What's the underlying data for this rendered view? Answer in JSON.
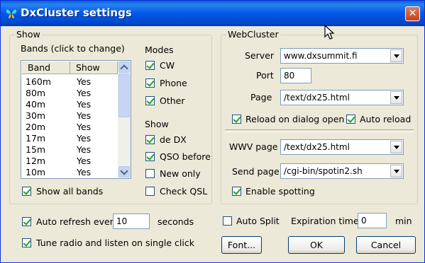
{
  "window": {
    "title": "DxCluster settings",
    "close_label": "✕"
  },
  "show_group": {
    "label": "Show",
    "bands_label": "Bands (click to change)",
    "bands_header": {
      "band": "Band",
      "show": "Show"
    },
    "bands": [
      {
        "band": "160m",
        "show": "Yes"
      },
      {
        "band": "80m",
        "show": "Yes"
      },
      {
        "band": "40m",
        "show": "Yes"
      },
      {
        "band": "30m",
        "show": "Yes"
      },
      {
        "band": "20m",
        "show": "Yes"
      },
      {
        "band": "17m",
        "show": "Yes"
      },
      {
        "band": "15m",
        "show": "Yes"
      },
      {
        "band": "12m",
        "show": "Yes"
      },
      {
        "band": "10m",
        "show": "Yes"
      }
    ],
    "show_all_bands": {
      "label": "Show all bands",
      "checked": true
    },
    "modes_label": "Modes",
    "modes": [
      {
        "label": "CW",
        "checked": true
      },
      {
        "label": "Phone",
        "checked": true
      },
      {
        "label": "Other",
        "checked": true
      }
    ],
    "show_label": "Show",
    "show_options": [
      {
        "label": "de DX",
        "checked": true
      },
      {
        "label": "QSO before",
        "checked": true
      },
      {
        "label": "New only",
        "checked": false
      },
      {
        "label": "Check QSL",
        "checked": false
      }
    ]
  },
  "webcluster": {
    "label": "WebCluster",
    "server_label": "Server",
    "server_value": "www.dxsummit.fi",
    "port_label": "Port",
    "port_value": "80",
    "page_label": "Page",
    "page_value": "/text/dx25.html",
    "reload_on_open": {
      "label": "Reload on dialog open",
      "checked": true
    },
    "auto_reload": {
      "label": "Auto reload",
      "checked": true
    },
    "wwv_label": "WWV page",
    "wwv_value": "/text/dx25.html",
    "send_label": "Send page",
    "send_value": "/cgi-bin/spotin2.sh",
    "enable_spotting": {
      "label": "Enable spotting",
      "checked": true
    }
  },
  "bottom": {
    "auto_refresh": {
      "label": "Auto refresh every",
      "checked": true
    },
    "refresh_value": "10",
    "seconds_label": "seconds",
    "tune_radio": {
      "label": "Tune radio and listen on single click",
      "checked": true
    },
    "auto_split": {
      "label": "Auto Split",
      "checked": false
    },
    "expiration_label": "Expiration time",
    "expiration_value": "0",
    "min_label": "min",
    "font_button": "Font...",
    "ok_button": "OK",
    "cancel_button": "Cancel"
  }
}
